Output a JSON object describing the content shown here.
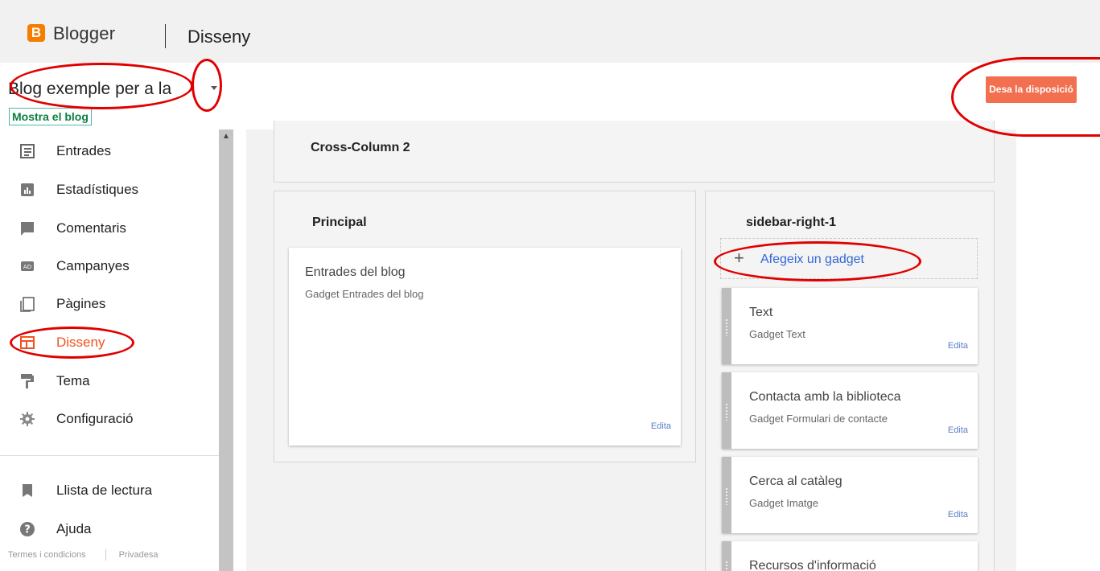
{
  "header": {
    "logo_letter": "B",
    "app_name": "Blogger",
    "page_title": "Disseny"
  },
  "blog_bar": {
    "blog_name": "Blog exemple per a la",
    "view_blog": "Mostra el blog",
    "save_button": "Desa la disposició"
  },
  "sidebar": {
    "items": [
      {
        "label": "Entrades",
        "icon": "posts-icon"
      },
      {
        "label": "Estadístiques",
        "icon": "stats-icon"
      },
      {
        "label": "Comentaris",
        "icon": "comments-icon"
      },
      {
        "label": "Campanyes",
        "icon": "campaigns-icon"
      },
      {
        "label": "Pàgines",
        "icon": "pages-icon"
      },
      {
        "label": "Disseny",
        "icon": "layout-icon"
      },
      {
        "label": "Tema",
        "icon": "theme-icon"
      },
      {
        "label": "Configuració",
        "icon": "settings-icon"
      }
    ],
    "secondary": [
      {
        "label": "Llista de lectura",
        "icon": "bookmark-icon"
      },
      {
        "label": "Ajuda",
        "icon": "help-icon"
      }
    ],
    "footer": {
      "terms": "Termes i condicions",
      "privacy": "Privadesa"
    },
    "active_color": "#f4511e"
  },
  "layout": {
    "cross_column": {
      "title": "Cross-Column 2"
    },
    "main": {
      "title": "Principal",
      "gadgets": [
        {
          "title": "Entrades del blog",
          "subtitle": "Gadget Entrades del blog",
          "edit": "Edita"
        }
      ]
    },
    "sidebar_right": {
      "title": "sidebar-right-1",
      "add_gadget": "Afegeix un gadget",
      "gadgets": [
        {
          "title": "Text",
          "subtitle": "Gadget Text",
          "edit": "Edita"
        },
        {
          "title": "Contacta amb la biblioteca",
          "subtitle": "Gadget Formulari de contacte",
          "edit": "Edita"
        },
        {
          "title": "Cerca al catàleg",
          "subtitle": "Gadget Imatge",
          "edit": "Edita"
        },
        {
          "title": "Recursos d'informació"
        }
      ]
    }
  },
  "colors": {
    "brand": "#f57d00",
    "save_button": "#f26f4f",
    "annotation": "#e00000",
    "link": "#3367d6"
  }
}
